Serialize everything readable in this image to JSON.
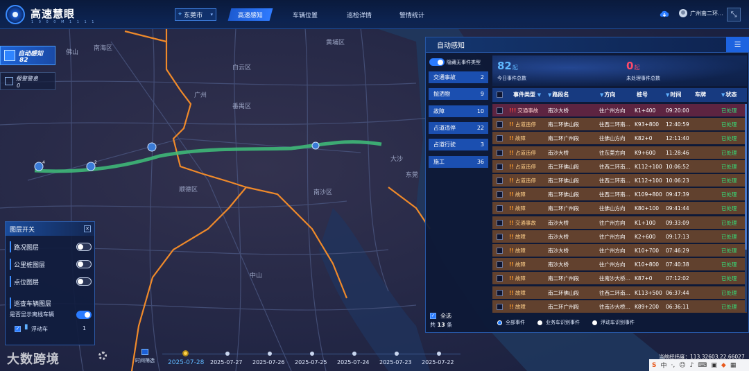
{
  "header": {
    "brand": "高速慧眼",
    "brand_sub": "1 0 0 0 M 1 1 1 1",
    "city": "东莞市",
    "nav": [
      "高速感知",
      "车辆位置",
      "巡检详情",
      "警情统计"
    ],
    "user": "广州南二环…",
    "icons": {
      "city": "location-pin-icon",
      "cloud": "cloud-download-icon",
      "expand": "fullscreen-icon",
      "user": "user-avatar-icon"
    }
  },
  "badges": {
    "auto_title": "自动感知",
    "auto_count": "82",
    "alarm_title": "报警警息",
    "alarm_count": "0"
  },
  "map": {
    "labels": [
      "佛山",
      "南海区",
      "白云区",
      "番禺区",
      "顺德区",
      "南沙区",
      "黄埔区",
      "广州",
      "东莞",
      "中山",
      "大沙"
    ],
    "markers": [
      {
        "count": "4"
      },
      {
        "count": "2"
      }
    ]
  },
  "layers": {
    "title": "图层开关",
    "items": [
      {
        "label": "路况图层",
        "on": false
      },
      {
        "label": "公里桩图层",
        "on": false
      },
      {
        "label": "点位图层",
        "on": false
      }
    ],
    "patrol_title": "巡查车辆图层",
    "offline_label": "是否显示离线车辆",
    "offline_on": true,
    "vehicle_label": "浮动车",
    "vehicle_count": "1"
  },
  "panel": {
    "title": "自动感知",
    "hide_label": "隐藏无事件类型",
    "categories": [
      {
        "label": "交通事故",
        "count": "2"
      },
      {
        "label": "抛洒物",
        "count": "9"
      },
      {
        "label": "故障",
        "count": "10"
      },
      {
        "label": "占道违停",
        "count": "22"
      },
      {
        "label": "占道行驶",
        "count": "3"
      },
      {
        "label": "施工",
        "count": "36"
      }
    ],
    "select_all": "全选",
    "total_prefix": "共",
    "total_count": "13",
    "total_suffix": "条",
    "today_count": "82",
    "today_unit": "起",
    "today_label": "今日事件总数",
    "pending_count": "0",
    "pending_unit": "起",
    "pending_label": "未处理事件总数",
    "columns": [
      "事件类型",
      "路段名",
      "方向",
      "桩号",
      "时间",
      "车牌",
      "状态"
    ],
    "rows": [
      {
        "mark": "!!!",
        "type": "交通事故",
        "road": "南沙大桥",
        "dir": "往广州方向",
        "stake": "K1+400",
        "time": "09:20:00",
        "plate": "",
        "status": "已处理"
      },
      {
        "mark": "!!",
        "type": "占道违停",
        "road": "南二环佛山段",
        "dir": "往西二环南…",
        "stake": "K93+800",
        "time": "12:40:59",
        "plate": "",
        "status": "已处理"
      },
      {
        "mark": "!!",
        "type": "故障",
        "road": "南二环广州段",
        "dir": "往佛山方向",
        "stake": "K82+0",
        "time": "12:11:40",
        "plate": "",
        "status": "已处理"
      },
      {
        "mark": "!!",
        "type": "占道违停",
        "road": "南沙大桥",
        "dir": "往东莞方向",
        "stake": "K9+600",
        "time": "11:28:46",
        "plate": "",
        "status": "已处理"
      },
      {
        "mark": "!!",
        "type": "占道违停",
        "road": "南二环佛山段",
        "dir": "往西二环南…",
        "stake": "K112+100",
        "time": "10:06:52",
        "plate": "",
        "status": "已处理"
      },
      {
        "mark": "!!",
        "type": "占道违停",
        "road": "南二环佛山段",
        "dir": "往西二环南…",
        "stake": "K112+100",
        "time": "10:06:23",
        "plate": "",
        "status": "已处理"
      },
      {
        "mark": "!!",
        "type": "故障",
        "road": "南二环佛山段",
        "dir": "往西二环南…",
        "stake": "K109+800",
        "time": "09:47:39",
        "plate": "",
        "status": "已处理"
      },
      {
        "mark": "!!",
        "type": "故障",
        "road": "南二环广州段",
        "dir": "往佛山方向",
        "stake": "K80+100",
        "time": "09:41:44",
        "plate": "",
        "status": "已处理"
      },
      {
        "mark": "!!",
        "type": "交通事故",
        "road": "南沙大桥",
        "dir": "往广州方向",
        "stake": "K1+100",
        "time": "09:33:09",
        "plate": "",
        "status": "已处理"
      },
      {
        "mark": "!!",
        "type": "故障",
        "road": "南沙大桥",
        "dir": "往广州方向",
        "stake": "K2+600",
        "time": "09:17:13",
        "plate": "",
        "status": "已处理"
      },
      {
        "mark": "!!",
        "type": "故障",
        "road": "南沙大桥",
        "dir": "往广州方向",
        "stake": "K10+700",
        "time": "07:46:29",
        "plate": "",
        "status": "已处理"
      },
      {
        "mark": "!!",
        "type": "故障",
        "road": "南沙大桥",
        "dir": "往广州方向",
        "stake": "K10+800",
        "time": "07:40:38",
        "plate": "",
        "status": "已处理"
      },
      {
        "mark": "!!",
        "type": "故障",
        "road": "南二环广州段",
        "dir": "往南沙大桥…",
        "stake": "K87+0",
        "time": "07:12:02",
        "plate": "",
        "status": "已处理"
      },
      {
        "mark": "!!",
        "type": "故障",
        "road": "南二环佛山段",
        "dir": "往西二环南…",
        "stake": "K113+500",
        "time": "06:37:44",
        "plate": "",
        "status": "已处理"
      },
      {
        "mark": "!!",
        "type": "故障",
        "road": "南二环广州段",
        "dir": "往南沙大桥…",
        "stake": "K89+200",
        "time": "06:36:11",
        "plate": "",
        "status": "已处理"
      }
    ],
    "filters": [
      "全部事件",
      "业务车识别事件",
      "浮动车识别事件"
    ]
  },
  "timeline": {
    "label": "时间筛选",
    "dates": [
      "2025-07-28",
      "2025-07-27",
      "2025-07-26",
      "2025-07-25",
      "2025-07-24",
      "2025-07-23",
      "2025-07-22"
    ]
  },
  "footer": {
    "watermark": "大数跨境",
    "coords_label": "当前经纬度：",
    "coords_value": "113.32603,22.66027",
    "ime": [
      "S",
      "中",
      "·,",
      "☺",
      "♪",
      "⌨",
      "▣",
      "◆",
      "▦"
    ]
  },
  "colors": {
    "accent": "#2a7bff",
    "status_ok": "#35e07a",
    "warn": "#ff9a2a",
    "road": "#f08a2a",
    "highway": "#3fbf7a"
  }
}
